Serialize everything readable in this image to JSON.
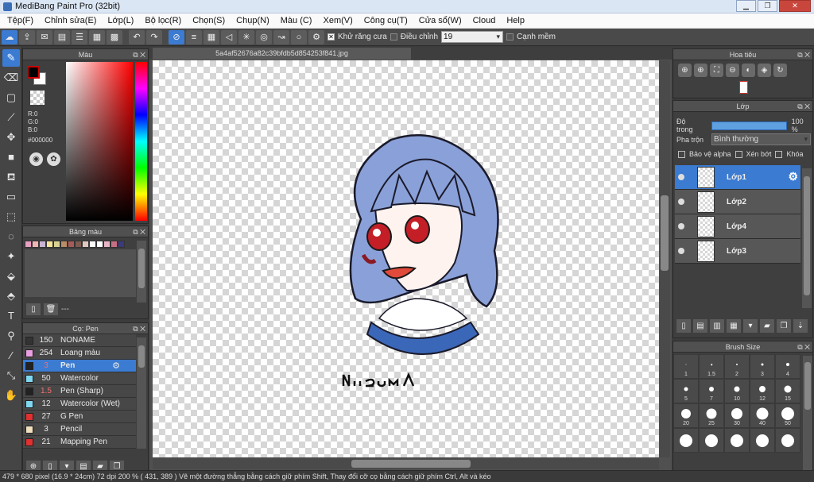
{
  "window": {
    "title": "MediBang Paint Pro (32bit)"
  },
  "menu": [
    "Tệp(F)",
    "Chỉnh sửa(E)",
    "Lớp(L)",
    "Bộ lọc(R)",
    "Chọn(S)",
    "Chụp(N)",
    "Màu (C)",
    "Xem(V)",
    "Công cụ(T)",
    "Cửa sổ(W)",
    "Cloud",
    "Help"
  ],
  "toolbar": {
    "antialias_label": "Khử răng cưa",
    "adjust_label": "Điều chỉnh",
    "adjust_value": "19",
    "edge_label": "Cạnh mềm"
  },
  "color_panel": {
    "title": "Màu",
    "r": "R:0",
    "g": "G:0",
    "b": "B:0",
    "hex": "#000000"
  },
  "palette_panel": {
    "title": "Bảng màu",
    "name": "---",
    "colors": [
      "#e99fc1",
      "#f2b3b5",
      "#c8b4d0",
      "#f5e39a",
      "#d9d290",
      "#b98d67",
      "#a75a5a",
      "#7e5b4f",
      "#e0c8c0",
      "#fafafa",
      "#ffffff",
      "#e9b5c5",
      "#c66f84",
      "#3a3a7c"
    ]
  },
  "brush_panel": {
    "title": "Cọ: Pen",
    "items": [
      {
        "size": "150",
        "name": "NONAME",
        "color": "#333333"
      },
      {
        "size": "254",
        "name": "Loang màu",
        "color": "#e99fe1"
      },
      {
        "size": "3",
        "name": "Pen",
        "color": "#222222"
      },
      {
        "size": "50",
        "name": "Watercolor",
        "color": "#7fd8f0"
      },
      {
        "size": "1.5",
        "name": "Pen (Sharp)",
        "color": "#222222"
      },
      {
        "size": "12",
        "name": "Watercolor (Wet)",
        "color": "#7fd8f0"
      },
      {
        "size": "27",
        "name": "G Pen",
        "color": "#e03030"
      },
      {
        "size": "3",
        "name": "Pencil",
        "color": "#f0e0c0"
      },
      {
        "size": "21",
        "name": "Mapping Pen",
        "color": "#e03030"
      }
    ]
  },
  "document": {
    "tab": "5a4af52676a82c39bfdb5d854253f841.jpg",
    "signature": "niizuma"
  },
  "navigator": {
    "title": "Hoa tiêu"
  },
  "layer_panel": {
    "title": "Lớp",
    "opacity_label": "Độ trong",
    "opacity_value": "100 %",
    "blend_label": "Pha trộn",
    "blend_value": "Bình thường",
    "protect_alpha": "Bảo vệ alpha",
    "clip": "Xén bớt",
    "lock": "Khóa",
    "layers": [
      {
        "name": "Lớp1"
      },
      {
        "name": "Lớp2"
      },
      {
        "name": "Lớp4"
      },
      {
        "name": "Lớp3"
      }
    ]
  },
  "brush_size_panel": {
    "title": "Brush Size",
    "sizes": [
      "1",
      "1.5",
      "2",
      "3",
      "4",
      "5",
      "7",
      "10",
      "12",
      "15",
      "20",
      "25",
      "30",
      "40",
      "50",
      "",
      "",
      "",
      "",
      ""
    ]
  },
  "status": {
    "text": "479 * 680 pixel   (16.9 * 24cm)   72 dpi   200 %   ( 431, 389 )   Vẽ một đường thẳng bằng cách giữ phím Shift, Thay đổi cỡ cọ bằng cách giữ phím Ctrl, Alt và kéo"
  }
}
